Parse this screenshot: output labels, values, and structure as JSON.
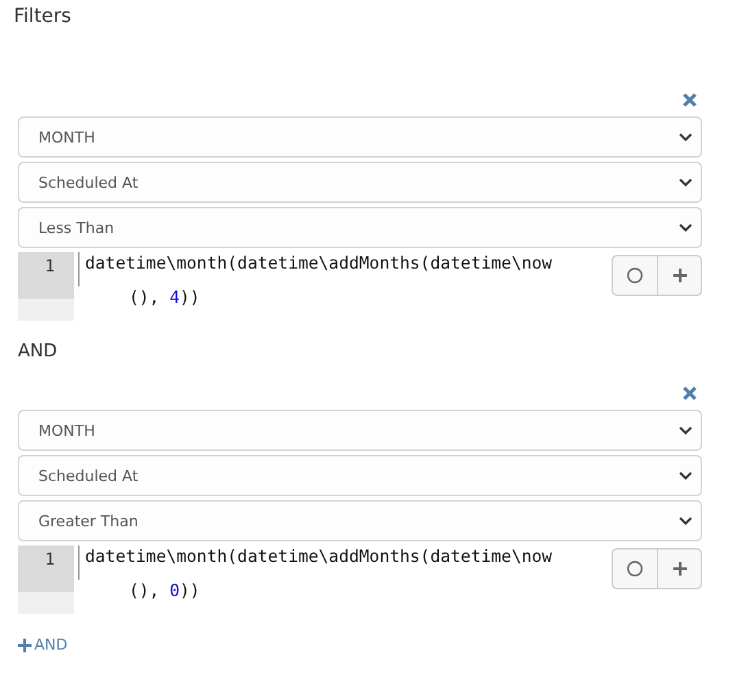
{
  "title": "Filters",
  "rules": [
    {
      "selects": [
        "MONTH",
        "Scheduled At",
        "Less Than"
      ],
      "line_number": "1",
      "code": {
        "first": "datetime\\month(datetime\\addMonths(datetime\\now",
        "continuation": "(), ",
        "number": "4",
        "tail": "))"
      }
    },
    {
      "selects": [
        "MONTH",
        "Scheduled At",
        "Greater Than"
      ],
      "line_number": "1",
      "code": {
        "first": "datetime\\month(datetime\\addMonths(datetime\\now",
        "continuation": "(), ",
        "number": "0",
        "tail": "))"
      }
    }
  ],
  "joiner": "AND",
  "add_button": "AND"
}
